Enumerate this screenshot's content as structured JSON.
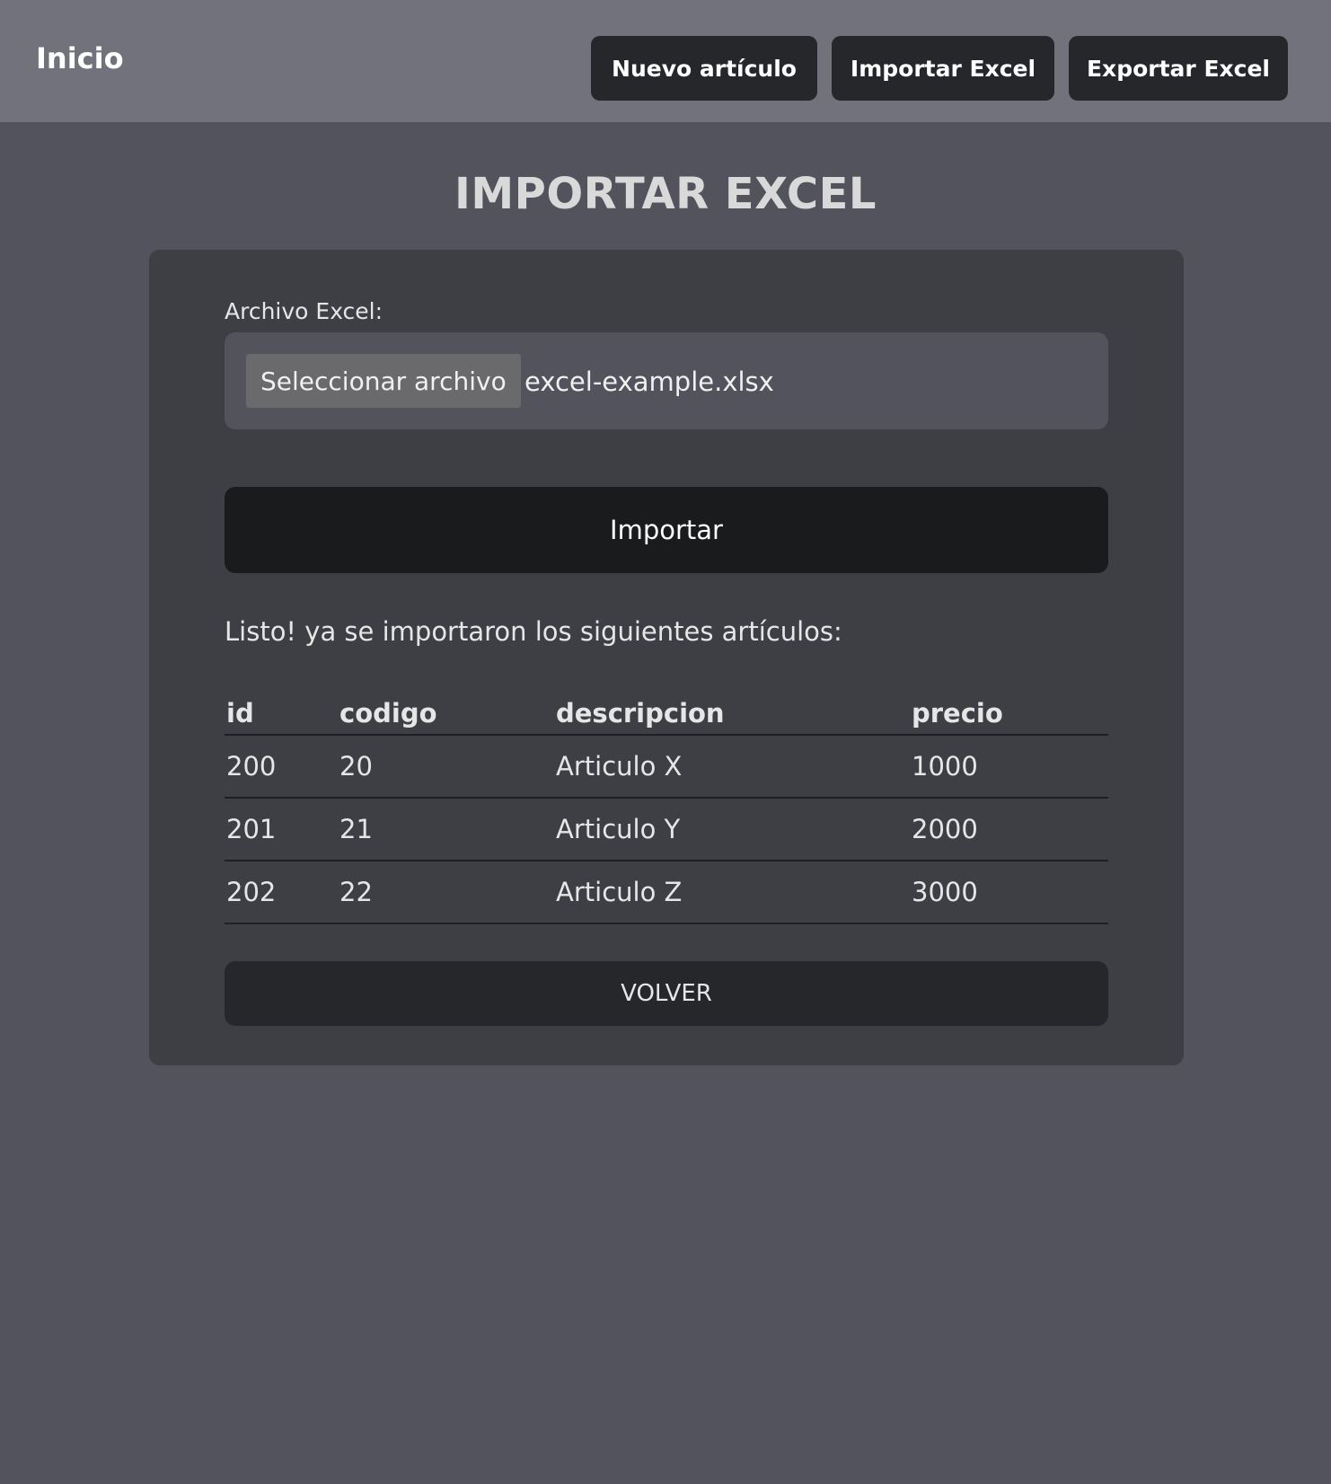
{
  "navbar": {
    "brand": "Inicio",
    "buttons": {
      "new_item": "Nuevo artículo",
      "import_excel": "Importar Excel",
      "export_excel": "Exportar Excel"
    }
  },
  "page": {
    "title": "IMPORTAR EXCEL"
  },
  "form": {
    "file_label": "Archivo Excel:",
    "file_button": "Seleccionar archivo",
    "file_name": "excel-example.xlsx",
    "submit_label": "Importar"
  },
  "result": {
    "message": "Listo! ya se importaron los siguientes artículos:",
    "table": {
      "headers": [
        "id",
        "codigo",
        "descripcion",
        "precio"
      ],
      "rows": [
        [
          "200",
          "20",
          "Articulo X",
          "1000"
        ],
        [
          "201",
          "21",
          "Articulo Y",
          "2000"
        ],
        [
          "202",
          "22",
          "Articulo Z",
          "3000"
        ]
      ]
    }
  },
  "footer_actions": {
    "back_label": "VOLVER"
  },
  "colors": {
    "page_bg": "#52535c",
    "navbar_bg": "#71727b",
    "card_bg": "#3e3f44",
    "button_dark": "#26272b",
    "submit_bg": "#1a1b1d"
  }
}
